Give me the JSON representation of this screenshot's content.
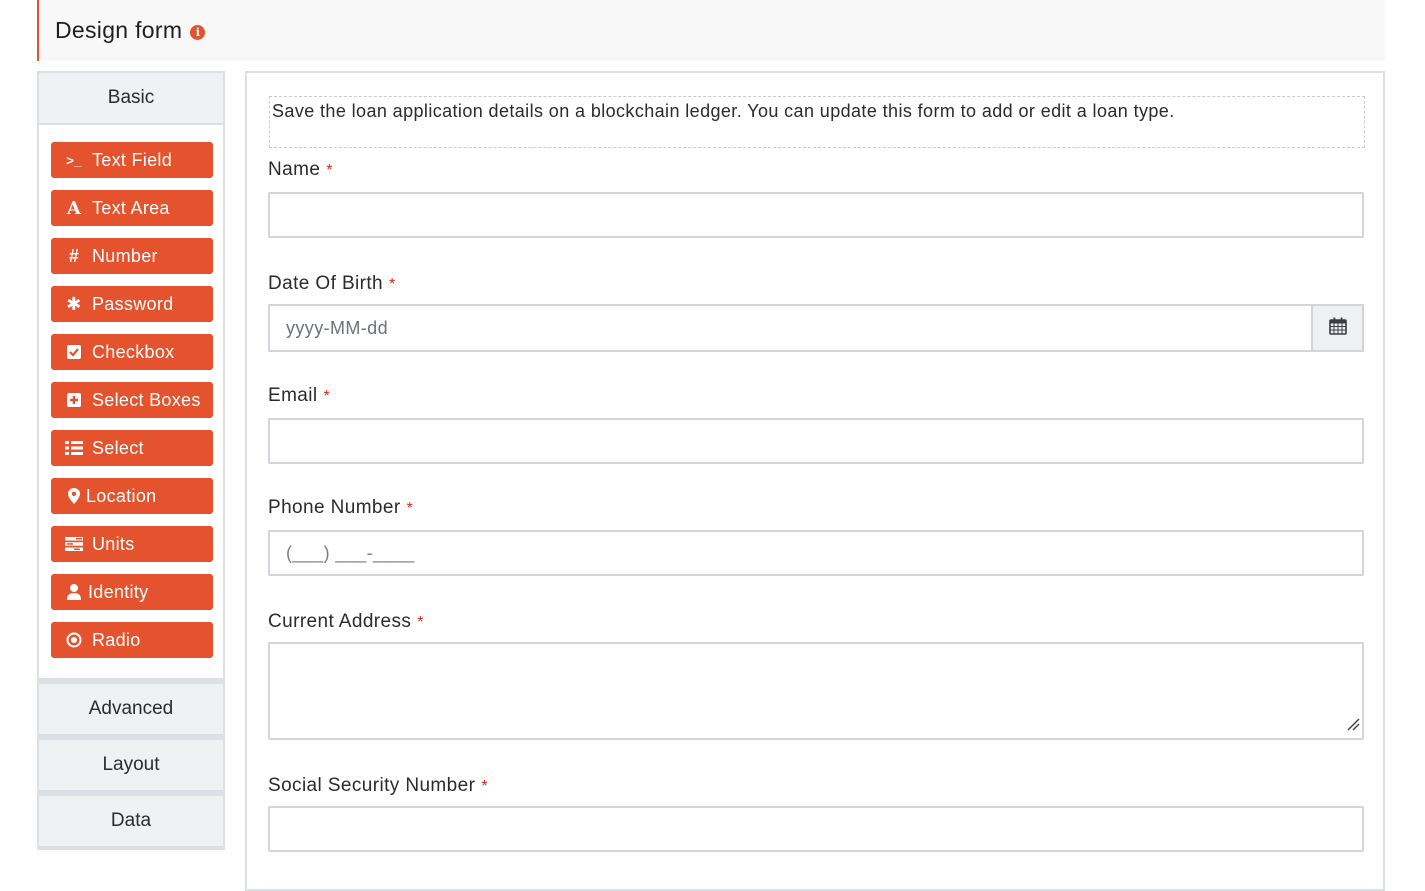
{
  "header": {
    "title": "Design form",
    "info_icon": "info-icon"
  },
  "sidebar": {
    "basic_label": "Basic",
    "components": [
      {
        "label": "Text Field",
        "icon": "terminal-icon"
      },
      {
        "label": "Text Area",
        "icon": "font-icon"
      },
      {
        "label": "Number",
        "icon": "hashtag-icon"
      },
      {
        "label": "Password",
        "icon": "asterisk-icon"
      },
      {
        "label": "Checkbox",
        "icon": "check-square-icon"
      },
      {
        "label": "Select Boxes",
        "icon": "plus-square-icon"
      },
      {
        "label": "Select",
        "icon": "list-icon"
      },
      {
        "label": "Location",
        "icon": "map-marker-icon"
      },
      {
        "label": "Units",
        "icon": "tasks-icon"
      },
      {
        "label": "Identity",
        "icon": "user-icon"
      },
      {
        "label": "Radio",
        "icon": "dot-circle-icon"
      }
    ],
    "advanced_label": "Advanced",
    "layout_label": "Layout",
    "data_label": "Data"
  },
  "form": {
    "description": "Save the loan application details on a blockchain ledger. You can update this form to add or edit a loan type.",
    "required_mark": "*",
    "fields": {
      "name": {
        "label": "Name",
        "value": ""
      },
      "dob": {
        "label": "Date Of Birth",
        "placeholder": "yyyy-MM-dd",
        "icon": "calendar-icon"
      },
      "email": {
        "label": "Email",
        "value": ""
      },
      "phone": {
        "label": "Phone Number",
        "placeholder": "(___) ___-____"
      },
      "address": {
        "label": "Current Address",
        "value": ""
      },
      "ssn": {
        "label": "Social Security Number",
        "value": ""
      }
    }
  },
  "colors": {
    "accent": "#e5532e",
    "required": "#d9261c",
    "border": "#d2d6db"
  }
}
